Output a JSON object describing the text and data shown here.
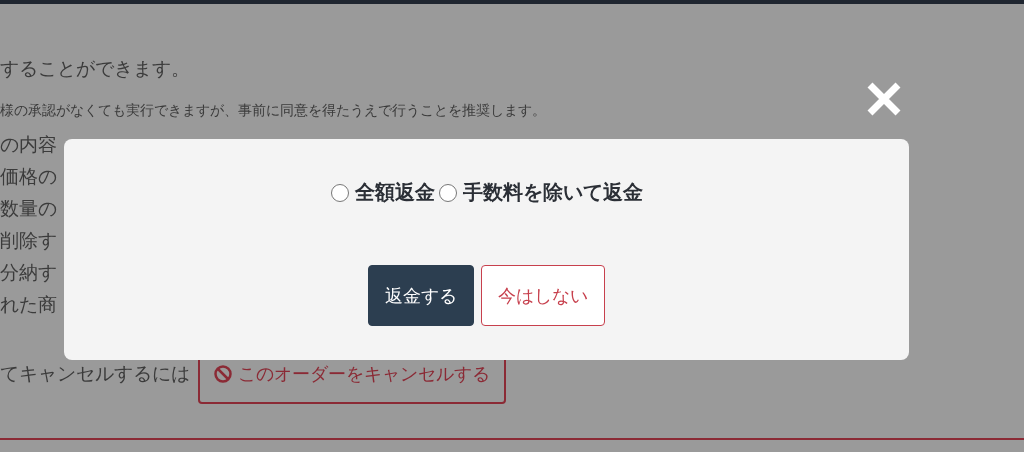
{
  "page": {
    "lines": [
      {
        "kind": "lead",
        "text": "することができます。"
      },
      {
        "kind": "note",
        "text": "様の承認がなくても実行できますが、事前に同意を得たうえで行うことを推奨します。"
      },
      {
        "kind": "lead",
        "text": "の内容"
      },
      {
        "kind": "item",
        "text": "価格の"
      },
      {
        "kind": "item",
        "text": "数量の"
      },
      {
        "kind": "item",
        "text": "削除す"
      },
      {
        "kind": "item",
        "text": "分納す"
      },
      {
        "kind": "item",
        "text": "れた商"
      }
    ],
    "cancel_prompt": "てキャンセルするには",
    "cancel_button": "このオーダーをキャンセルする"
  },
  "dialog": {
    "options": [
      {
        "label": "全額返金",
        "selected": false
      },
      {
        "label": "手数料を除いて返金",
        "selected": false
      }
    ],
    "buttons": [
      {
        "label": "返金する",
        "kind": "primary"
      },
      {
        "label": "今はしない",
        "kind": "secondary"
      }
    ]
  }
}
